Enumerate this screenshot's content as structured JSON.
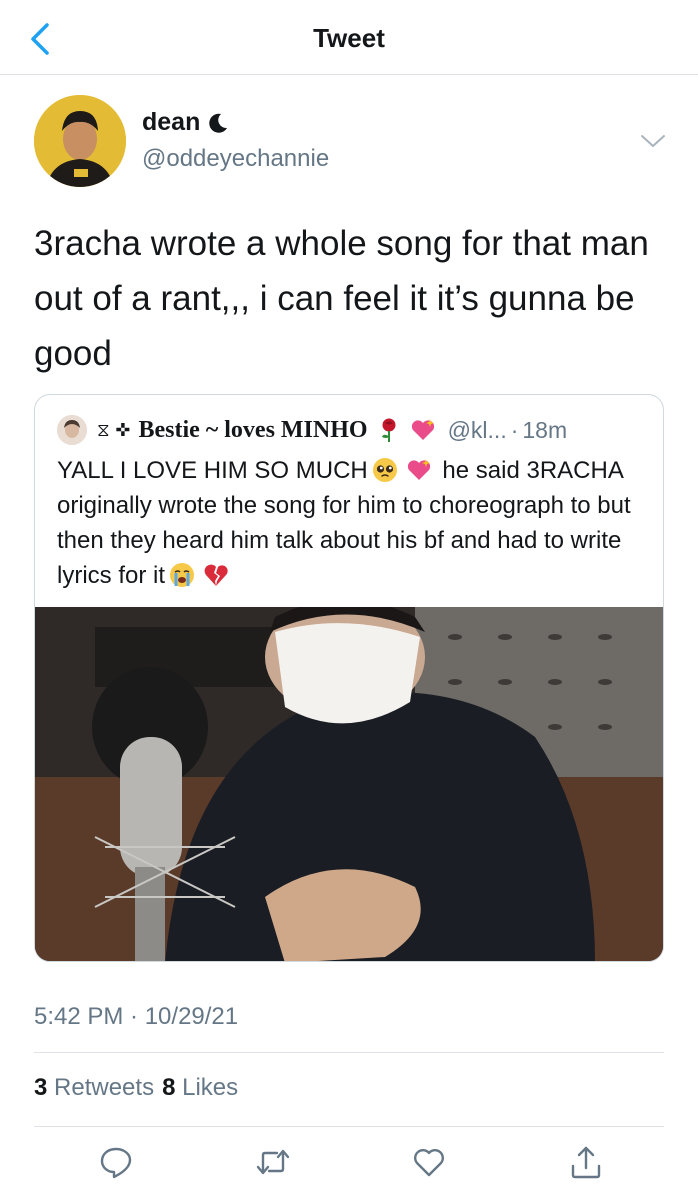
{
  "nav": {
    "title": "Tweet",
    "back_icon": "chevron-left-icon"
  },
  "author": {
    "display_name": "dean",
    "handle": "@oddeyechannie"
  },
  "tweet": {
    "text": "3racha wrote a whole song for that man out of a rant,,, i can feel it it’s gunna be good"
  },
  "quote": {
    "name_prefix": "⧖ ✜",
    "name": "Bestie ~ loves MINHO",
    "handle": "@kl...",
    "separator": "·",
    "time": "18m",
    "text_1": "YALL I LOVE HIM SO MUCH",
    "text_2": "he said 3RACHA originally wrote the song for him to choreograph to but then they heard him talk about his bf and had to write lyrics for it",
    "media_alt": "person in a white face mask at a studio microphone"
  },
  "meta": {
    "timestamp": "5:42 PM · 10/29/21"
  },
  "stats": {
    "retweets_count": "3",
    "retweets_label": "Retweets",
    "likes_count": "8",
    "likes_label": "Likes"
  },
  "colors": {
    "accent": "#1da1f2",
    "secondary_text": "#657786",
    "text": "#14171a",
    "divider": "#dfe3e7"
  }
}
